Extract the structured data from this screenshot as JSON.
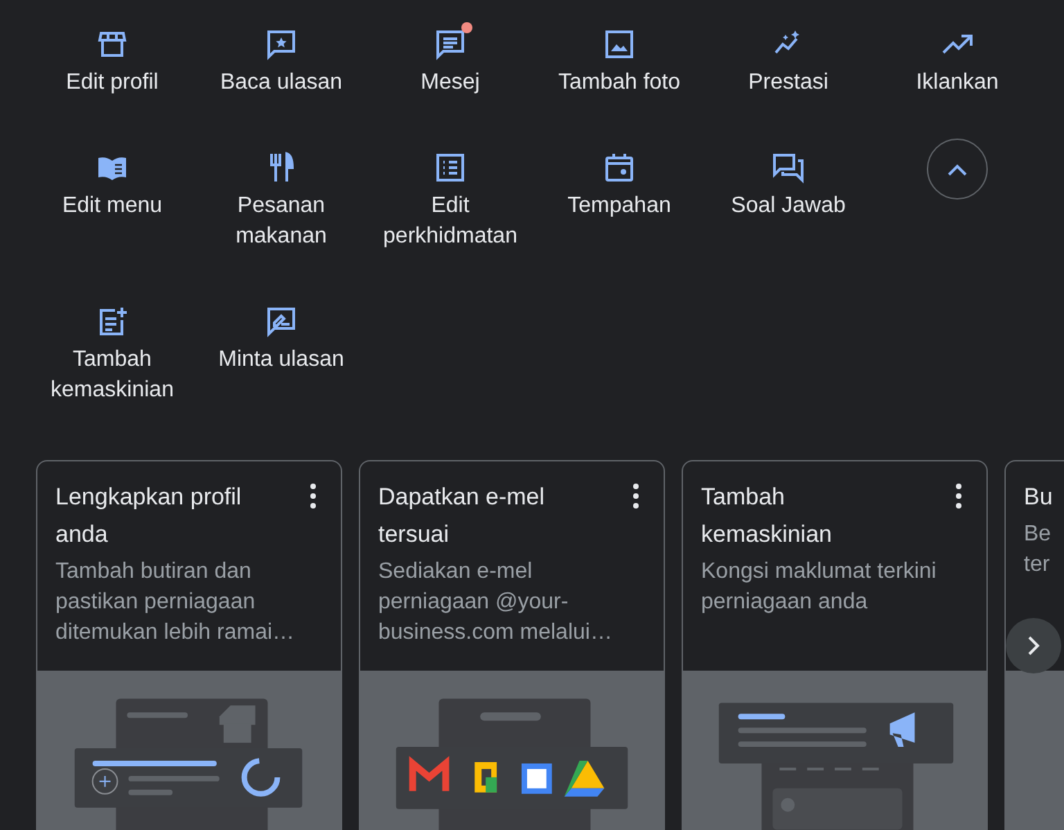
{
  "actions": [
    {
      "label": "Edit profil",
      "dot": false
    },
    {
      "label": "Baca ulasan",
      "dot": false
    },
    {
      "label": "Mesej",
      "dot": true
    },
    {
      "label": "Tambah foto",
      "dot": false
    },
    {
      "label": "Prestasi",
      "dot": false
    },
    {
      "label": "Iklankan",
      "dot": false
    },
    {
      "label": "Edit menu",
      "dot": false
    },
    {
      "label": "Pesanan makanan",
      "dot": false
    },
    {
      "label": "Edit perkhidmatan",
      "dot": false
    },
    {
      "label": "Tempahan",
      "dot": false
    },
    {
      "label": "Soal Jawab",
      "dot": false
    },
    {
      "label": "Tambah kemaskinian",
      "dot": false
    },
    {
      "label": "Minta ulasan",
      "dot": false
    }
  ],
  "cards": [
    {
      "kind": "full",
      "title": "Lengkapkan profil anda",
      "description": "Tambah butiran dan pastikan perniagaan ditemukan lebih ramai…"
    },
    {
      "kind": "full",
      "title": "Dapatkan e-mel tersuai",
      "description": "Sediakan e-mel perniagaan @your-business.com melalui…"
    },
    {
      "kind": "full",
      "title": "Tambah kemaskinian",
      "description": "Kongsi maklumat terkini perniagaan anda"
    },
    {
      "kind": "cut",
      "title": "Bu",
      "description": "Be ter"
    }
  ]
}
